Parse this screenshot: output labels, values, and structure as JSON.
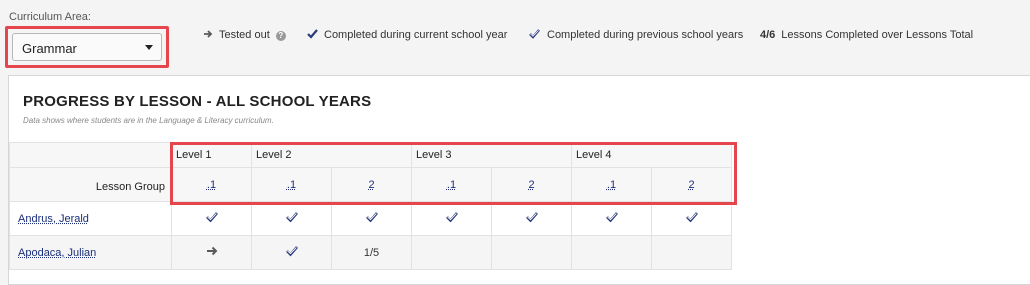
{
  "filter": {
    "label": "Curriculum Area:",
    "selected": "Grammar"
  },
  "legend": {
    "tested_out": "Tested out",
    "completed_current": "Completed during current school year",
    "completed_previous": "Completed during previous school years",
    "ratio_example": "4/6",
    "ratio_text": "Lessons Completed over Lessons Total"
  },
  "panel": {
    "title": "PROGRESS BY LESSON - ALL SCHOOL YEARS",
    "subtitle": "Data shows where students are in the Language & Literacy curriculum."
  },
  "table": {
    "lesson_group_label": "Lesson Group",
    "levels": [
      "Level 1",
      "Level 2",
      "Level 3",
      "Level 4"
    ],
    "lessons": [
      ".1",
      ".1",
      "2",
      ".1",
      "2",
      ".1",
      "2"
    ],
    "rows": [
      {
        "name": "Andrus, Jerald",
        "cells": [
          "check-current",
          "check-current",
          "check-current",
          "check-current",
          "check-current",
          "check-current",
          "check-current"
        ]
      },
      {
        "name": "Apodaca, Julian",
        "cells": [
          "arrow",
          "check-current",
          "1/5",
          "",
          "",
          "",
          ""
        ]
      }
    ]
  },
  "colors": {
    "highlight": "#e5454c",
    "link": "#1a2e7a",
    "icon": "#2b3a7a",
    "arrow": "#5a5a5a"
  }
}
